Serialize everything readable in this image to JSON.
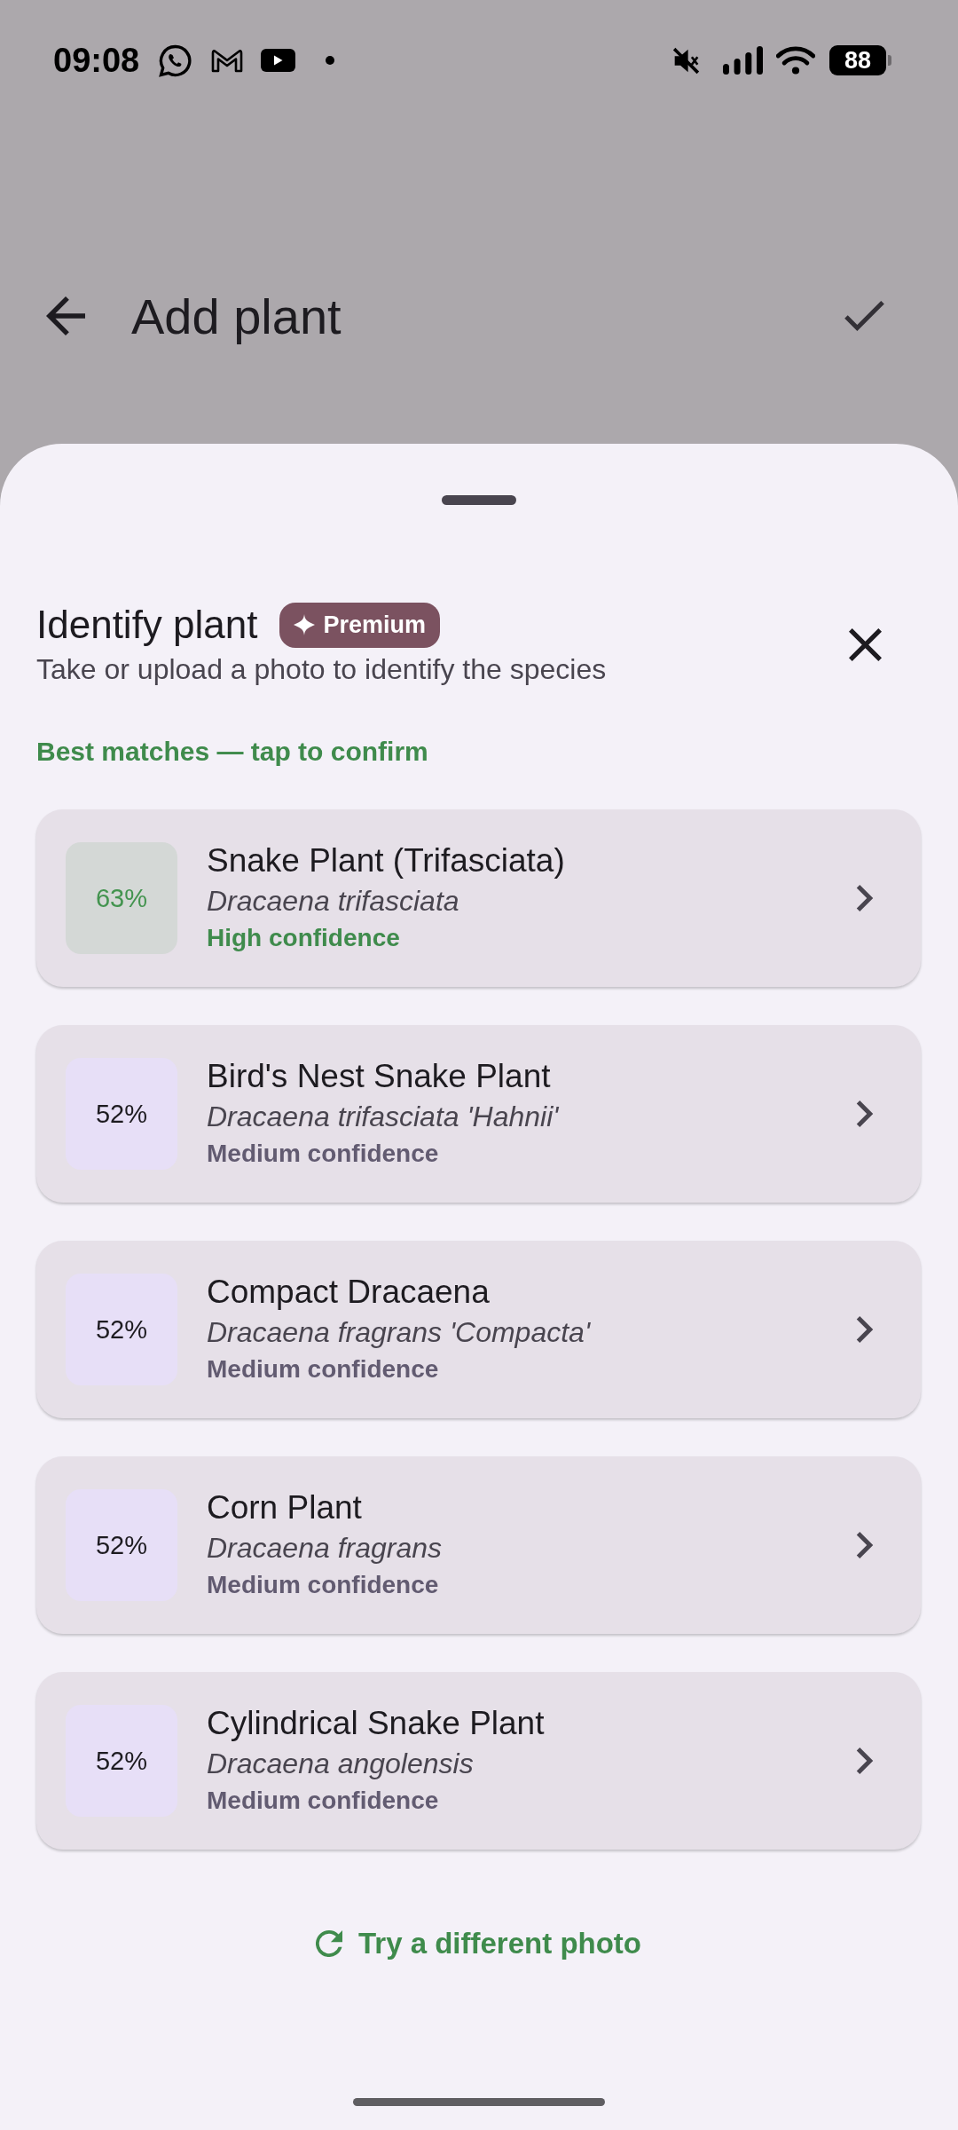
{
  "status_bar": {
    "time": "09:08",
    "battery": "88"
  },
  "app_bar": {
    "title": "Add plant"
  },
  "sheet": {
    "title": "Identify plant",
    "badge": "Premium",
    "subtitle": "Take or upload a photo to identify the species",
    "section_label": "Best matches — tap to confirm",
    "matches": [
      {
        "kind": "high",
        "score": "63%",
        "name": "Snake Plant (Trifasciata)",
        "scientific_name": "Dracaena trifasciata",
        "confidence": "High confidence"
      },
      {
        "kind": "medium",
        "score": "52%",
        "name": "Bird's Nest Snake Plant",
        "scientific_name": "Dracaena trifasciata 'Hahnii'",
        "confidence": "Medium confidence"
      },
      {
        "kind": "medium",
        "score": "52%",
        "name": "Compact Dracaena",
        "scientific_name": "Dracaena fragrans 'Compacta'",
        "confidence": "Medium confidence"
      },
      {
        "kind": "medium",
        "score": "52%",
        "name": "Corn Plant",
        "scientific_name": "Dracaena fragrans",
        "confidence": "Medium confidence"
      },
      {
        "kind": "medium",
        "score": "52%",
        "name": "Cylindrical Snake Plant",
        "scientific_name": "Dracaena angolensis",
        "confidence": "Medium confidence"
      }
    ],
    "retry_button": "Try a different photo"
  }
}
